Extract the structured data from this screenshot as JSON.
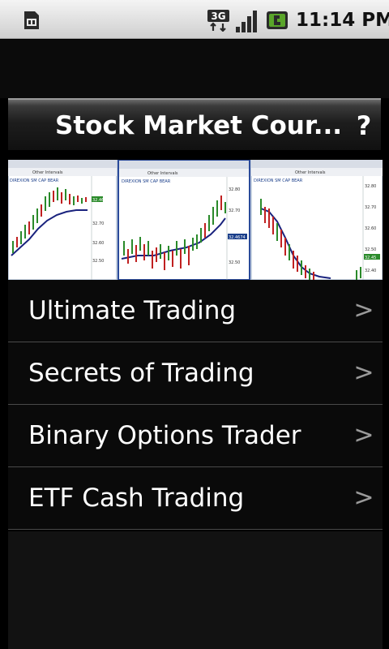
{
  "status_bar": {
    "time": "11:14 PM",
    "network": "3G",
    "icons": [
      "sim-icon",
      "3g-data-icon",
      "signal-strength-icon",
      "battery-charging-icon"
    ]
  },
  "header": {
    "title": "Stock Market Cour...",
    "help_symbol": "?"
  },
  "banner": {
    "panel_labels": [
      "DIREXION SM CAP BEAR",
      "DIREXION SM CAP BEAR",
      "DIREXION SM CAP BEAR"
    ],
    "tab_labels": [
      "Other Intervals",
      "Other Intervals",
      "Other Intervals"
    ],
    "price_ticks": [
      "32.80",
      "32.70",
      "32.60",
      "32.50",
      "32.40"
    ],
    "highlight_values": [
      "32.46",
      "32.4674",
      "32.45"
    ]
  },
  "menu": {
    "items": [
      {
        "label": "Ultimate Trading",
        "chevron": ">"
      },
      {
        "label": "Secrets of Trading",
        "chevron": ">"
      },
      {
        "label": "Binary Options Trader",
        "chevron": ">"
      },
      {
        "label": "ETF Cash Trading",
        "chevron": ">"
      }
    ]
  },
  "colors": {
    "background": "#000000",
    "status_bar": "#e6e6e6",
    "text": "#ffffff",
    "chevron": "#9a9a9a",
    "divider": "#4a4a4a",
    "candle_up": "#2a8a2a",
    "candle_down": "#c02020",
    "ma_line": "#1a237e"
  }
}
